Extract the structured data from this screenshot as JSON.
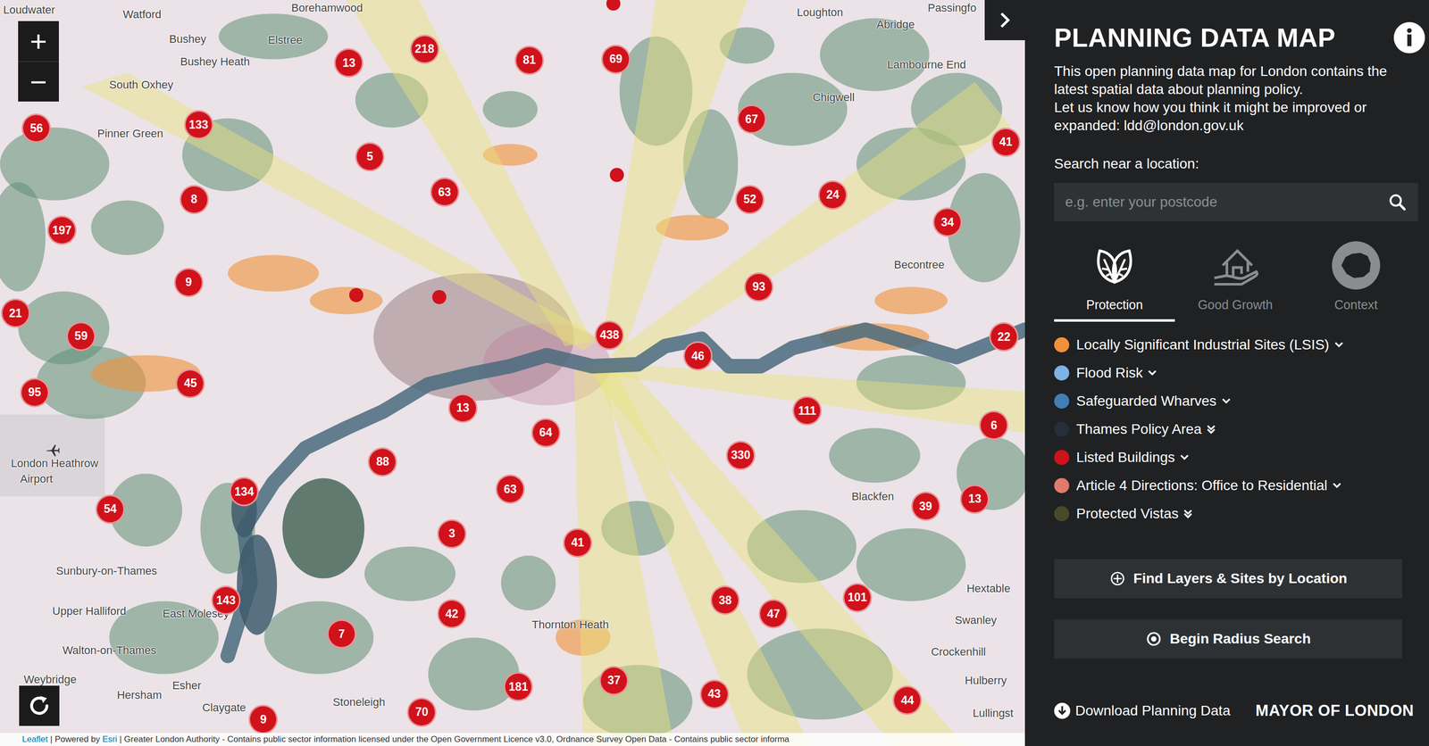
{
  "map": {
    "zoom_in": "+",
    "zoom_out": "−",
    "places": [
      "Loudwater",
      "Watford",
      "Borehamwood",
      "Loughton",
      "Abridge",
      "Passingfo",
      "Bushey",
      "Elstree",
      "Bushey Heath",
      "South Oxhey",
      "Lambourne End",
      "Chigwell",
      "Pinner Green",
      "Becontree",
      "London Heathrow",
      "Airport",
      "Sunbury-on-Thames",
      "Upper Halliford",
      "East Molesey",
      "Walton-on-Thames",
      "Weybridge",
      "Esher",
      "Hersham",
      "Claygate",
      "Stoneleigh",
      "Thornton Heath",
      "Blackfen",
      "Hextable",
      "Swanley",
      "Crockenhill",
      "Hulberry",
      "Lullingst"
    ],
    "clusters": [
      {
        "count": "13"
      },
      {
        "count": "218"
      },
      {
        "count": "81"
      },
      {
        "count": "69"
      },
      {
        "count": "133"
      },
      {
        "count": "56"
      },
      {
        "count": "5"
      },
      {
        "count": "67"
      },
      {
        "count": "41"
      },
      {
        "count": "8"
      },
      {
        "count": "63"
      },
      {
        "count": "52"
      },
      {
        "count": "24"
      },
      {
        "count": "34"
      },
      {
        "count": "197"
      },
      {
        "count": "9"
      },
      {
        "count": "93"
      },
      {
        "count": "21"
      },
      {
        "count": "59"
      },
      {
        "count": "438"
      },
      {
        "count": "46"
      },
      {
        "count": "22"
      },
      {
        "count": "95"
      },
      {
        "count": "45"
      },
      {
        "count": "13"
      },
      {
        "count": "111"
      },
      {
        "count": "64"
      },
      {
        "count": "6"
      },
      {
        "count": "330"
      },
      {
        "count": "88"
      },
      {
        "count": "134"
      },
      {
        "count": "63"
      },
      {
        "count": "39"
      },
      {
        "count": "13"
      },
      {
        "count": "54"
      },
      {
        "count": "3"
      },
      {
        "count": "41"
      },
      {
        "count": "143"
      },
      {
        "count": "42"
      },
      {
        "count": "38"
      },
      {
        "count": "47"
      },
      {
        "count": "101"
      },
      {
        "count": "7"
      },
      {
        "count": "181"
      },
      {
        "count": "37"
      },
      {
        "count": "43"
      },
      {
        "count": "44"
      },
      {
        "count": "70"
      },
      {
        "count": "9"
      }
    ],
    "attribution": {
      "leaflet": "Leaflet",
      "powered": "| Powered by",
      "esri": "Esri",
      "rest": "| Greater London Authority - Contains public sector information licensed under the Open Government Licence v3.0, Ordnance Survey Open Data - Contains public sector informa"
    }
  },
  "sidebar": {
    "title": "PLANNING DATA MAP",
    "description": [
      "This open planning data map for London contains the latest spatial data about planning policy.",
      "Let us know how you think it might be improved or expanded: ldd@london.gov.uk"
    ],
    "search": {
      "label": "Search near a location:",
      "placeholder": "e.g. enter your postcode"
    },
    "tabs": [
      {
        "label": "Protection",
        "selected": true
      },
      {
        "label": "Good Growth",
        "selected": false
      },
      {
        "label": "Context",
        "selected": false
      }
    ],
    "layers": [
      {
        "name": "Locally Significant Industrial Sites (LSIS)",
        "color": "#f0913a",
        "kind": "single"
      },
      {
        "name": "Flood Risk",
        "color": "#7fb2e5",
        "kind": "single"
      },
      {
        "name": "Safeguarded Wharves",
        "color": "#3f7fb4",
        "kind": "single"
      },
      {
        "name": "Thames Policy Area",
        "color": "#262d3b",
        "kind": "double"
      },
      {
        "name": "Listed Buildings",
        "color": "#d0121b",
        "kind": "single"
      },
      {
        "name": "Article 4 Directions: Office to Residential",
        "color": "#e07a6a",
        "kind": "single"
      },
      {
        "name": "Protected Vistas",
        "color": "#4a4a2a",
        "kind": "double"
      }
    ],
    "buttons": [
      "Find Layers & Sites by Location",
      "Begin Radius Search"
    ],
    "footer": {
      "download": "Download Planning Data",
      "brand": "MAYOR OF LONDON"
    }
  }
}
